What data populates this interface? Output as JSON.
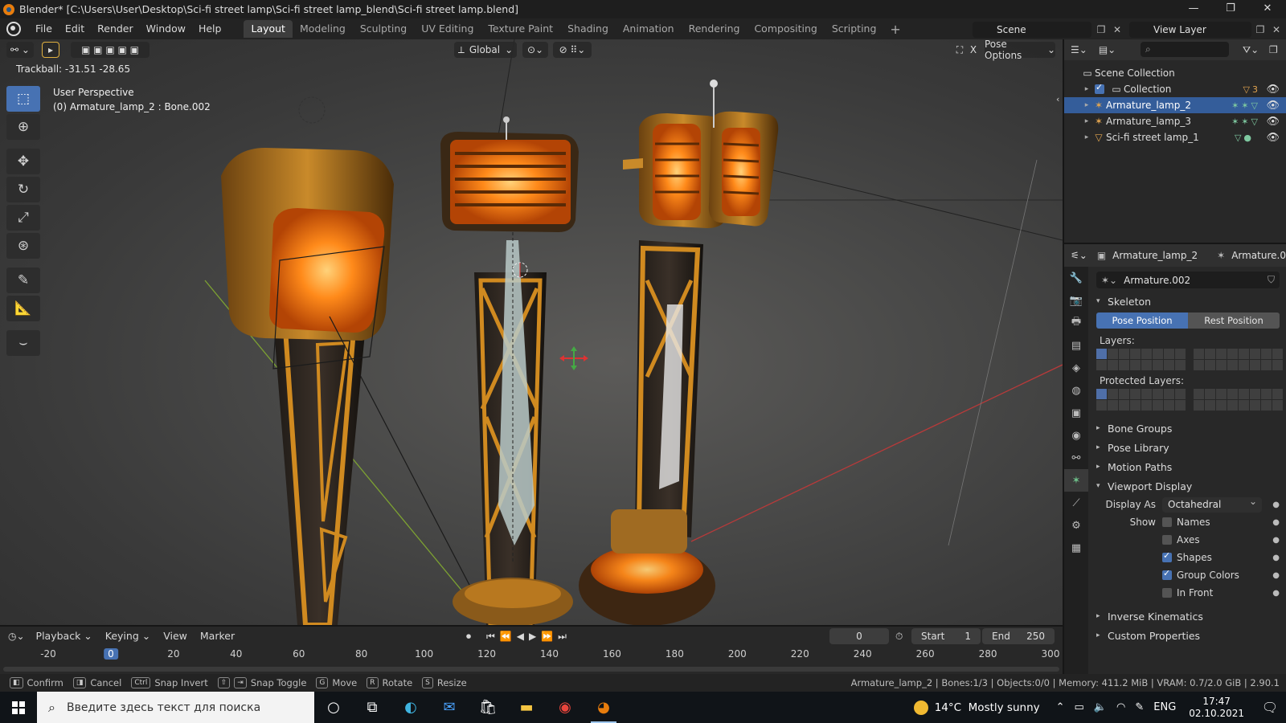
{
  "window": {
    "title": "Blender* [C:\\Users\\User\\Desktop\\Sci-fi street lamp\\Sci-fi street lamp_blend\\Sci-fi street lamp.blend]",
    "minimize": "—",
    "maximize": "❐",
    "close": "✕"
  },
  "menu": [
    "File",
    "Edit",
    "Render",
    "Window",
    "Help"
  ],
  "workspaces": [
    "Layout",
    "Modeling",
    "Sculpting",
    "UV Editing",
    "Texture Paint",
    "Shading",
    "Animation",
    "Rendering",
    "Compositing",
    "Scripting"
  ],
  "active_workspace": "Layout",
  "scene": {
    "name": "Scene",
    "view_layer": "View Layer"
  },
  "viewport": {
    "transform_orientation": "Global",
    "pose_options": "Pose Options",
    "trackball_readout": "Trackball: -31.51 -28.65",
    "perspective": "User Perspective",
    "active": "(0) Armature_lamp_2 : Bone.002",
    "close_x": "X"
  },
  "outliner": {
    "rows": [
      {
        "label": "Scene Collection",
        "icon": "scene-collection-icon"
      },
      {
        "label": "Collection",
        "icon": "collection-icon",
        "extra": "▽3"
      },
      {
        "label": "Armature_lamp_2",
        "icon": "armature-icon",
        "selected": true
      },
      {
        "label": "Armature_lamp_3",
        "icon": "armature-icon"
      },
      {
        "label": "Sci-fi street lamp_1",
        "icon": "mesh-icon"
      }
    ]
  },
  "properties": {
    "object_name": "Armature_lamp_2",
    "data_tab_name": "Armature.0",
    "data_name": "Armature.002",
    "skeleton_label": "Skeleton",
    "pose_position": "Pose Position",
    "rest_position": "Rest Position",
    "layers_label": "Layers:",
    "protected_layers_label": "Protected Layers:",
    "collapsed_panels_1": [
      "Bone Groups",
      "Pose Library",
      "Motion Paths"
    ],
    "viewport_display": "Viewport Display",
    "display_as_label": "Display As",
    "display_as_value": "Octahedral",
    "show_label": "Show",
    "checkboxes": [
      {
        "label": "Names",
        "checked": false
      },
      {
        "label": "Axes",
        "checked": false
      },
      {
        "label": "Shapes",
        "checked": true
      },
      {
        "label": "Group Colors",
        "checked": true
      },
      {
        "label": "In Front",
        "checked": false
      }
    ],
    "collapsed_panels_2": [
      "Inverse Kinematics",
      "Custom Properties"
    ]
  },
  "timeline": {
    "menus": [
      "Playback",
      "Keying",
      "View",
      "Marker"
    ],
    "current_frame": "0",
    "start_label": "Start",
    "start_value": "1",
    "end_label": "End",
    "end_value": "250",
    "ticks": [
      "-20",
      "0",
      "20",
      "40",
      "60",
      "80",
      "100",
      "120",
      "140",
      "160",
      "180",
      "200",
      "220",
      "240",
      "260",
      "280",
      "300"
    ],
    "current_tick": "0"
  },
  "statusbar": {
    "items": [
      {
        "key": "",
        "label": "Confirm"
      },
      {
        "key": "",
        "label": "Cancel"
      },
      {
        "key": "Ctrl",
        "label": "Snap Invert"
      },
      {
        "key": "⇧",
        "label": "Snap Toggle"
      },
      {
        "key": "G",
        "label": "Move"
      },
      {
        "key": "R",
        "label": "Rotate"
      },
      {
        "key": "S",
        "label": "Resize"
      }
    ],
    "stats": "Armature_lamp_2 | Bones:1/3 | Objects:0/0 | Memory: 411.2 MiB | VRAM: 0.7/2.0 GiB | 2.90.1"
  },
  "taskbar": {
    "search_placeholder": "Введите здесь текст для поиска",
    "weather_temp": "14°C",
    "weather_text": "Mostly sunny",
    "lang": "ENG",
    "time": "17:47",
    "date": "02.10.2021"
  },
  "colors": {
    "accent": "#4772b3",
    "selection": "#345d9a",
    "lamp_glow": "#ff8a1a"
  }
}
